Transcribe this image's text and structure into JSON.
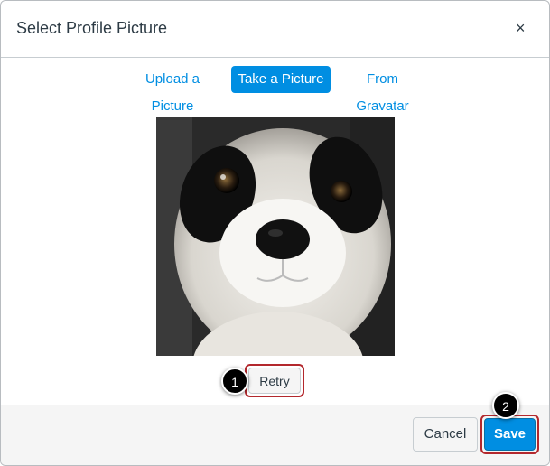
{
  "dialog": {
    "title": "Select Profile Picture",
    "close_symbol": "×",
    "close_icon": "close-icon"
  },
  "tabs": [
    {
      "label": "Upload a Picture",
      "active": false
    },
    {
      "label": "Take a Picture",
      "active": true
    },
    {
      "label": "From Gravatar",
      "active": false
    }
  ],
  "preview": {
    "image": "panda-plush-photo"
  },
  "actions": {
    "retry_label": "Retry",
    "cancel_label": "Cancel",
    "save_label": "Save"
  },
  "callouts": [
    {
      "number": "1",
      "target": "retry-button"
    },
    {
      "number": "2",
      "target": "save-button"
    }
  ],
  "colors": {
    "accent": "#008ee2",
    "highlight": "#b3282d",
    "text": "#2d3b45"
  }
}
